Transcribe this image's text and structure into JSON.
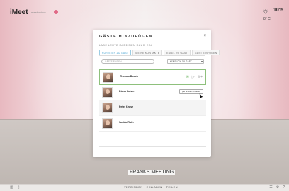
{
  "app": {
    "logo": "iMeet",
    "logo_sub": "meet  online"
  },
  "weather": {
    "time": "10:5",
    "temp": "8° C",
    "icon": "cloud-sun-icon"
  },
  "dialog": {
    "title": "GÄSTE HINZUFÜGEN",
    "close": "×",
    "subtitle": "LADE LEUTE IN DEINEN RAUM EIN",
    "tabs": [
      {
        "label": "KÜRZLICH ZU GAST"
      },
      {
        "label": "MEINE KONTAKTE"
      },
      {
        "label": "EMAIL ZU GAST"
      },
      {
        "label": "GAST EINFÜGEN"
      }
    ],
    "search_placeholder": "GÄSTE FINDEN",
    "select_value": "KÜRZLICH ZU GAST",
    "guests": [
      {
        "name": "Thomas Busch"
      },
      {
        "name": "Diana Kaiser"
      },
      {
        "name": "Peter Kruse"
      },
      {
        "name": "Saskia Roth"
      }
    ],
    "invite_button": "per E-Mail einladen"
  },
  "meeting": {
    "title": "FRANKS MEETING"
  },
  "bottombar": {
    "center": [
      "VERBINDEN",
      "EINLADEN",
      "TEILEN"
    ],
    "left_icons": [
      "chart-icon",
      "document-icon"
    ],
    "right_icons": [
      "grid-icon",
      "gear-icon",
      "help-icon"
    ]
  },
  "colors": {
    "accent": "#4aa5d2",
    "selected_border": "#8ec07c",
    "brand": "#e06a87"
  }
}
